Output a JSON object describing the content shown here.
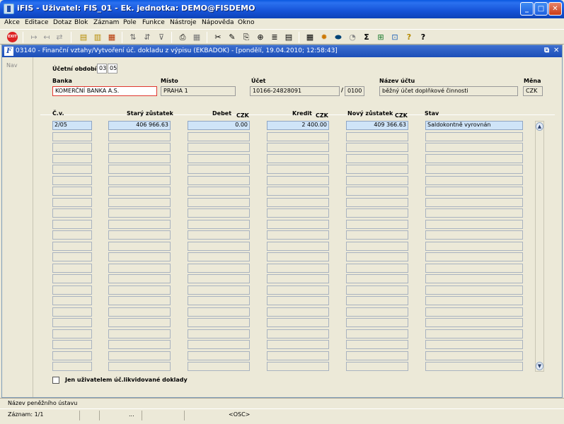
{
  "window": {
    "title": "iFIS - Uživatel: FIS_01 - Ek. jednotka: DEMO@FISDEMO",
    "min": "_",
    "max": "□",
    "close": "✕"
  },
  "menu": [
    "Akce",
    "Editace",
    "Dotaz",
    "Blok",
    "Záznam",
    "Pole",
    "Funkce",
    "Nástroje",
    "Nápověda",
    "Okno"
  ],
  "toolbar": {
    "exit_label": "EXIT",
    "icons": [
      "↦",
      "↤",
      "⇄",
      "▤",
      "▥",
      "▦",
      "⇅",
      "⇵",
      "⊽",
      "⎙",
      "▦",
      "✂",
      "✎",
      "⎘",
      "⊕",
      "≣",
      "▤",
      "▦",
      "✹",
      "⬬",
      "◔",
      "Σ",
      "⊞",
      "⊡",
      "?",
      "?"
    ]
  },
  "form": {
    "title": "03140 - Finanční vztahy/Vytvoření úč. dokladu z výpisu (EKBADOK) - [pondělí, 19.04.2010; 12:58:43]",
    "restore": "⧉",
    "close": "✕",
    "nav": "Nav",
    "period_label": "Účetní období",
    "period_year": "03",
    "period_month": "05",
    "bank_label": "Banka",
    "bank_value": "KOMERČNÍ BANKA A.S.",
    "place_label": "Místo",
    "place_value": "PRAHA 1",
    "account_label": "Účet",
    "account_value": "10166-24828091",
    "account_sep": "/",
    "bank_code": "0100",
    "account_name_label": "Název účtu",
    "account_name_value": "běžný účet doplňkové činnosti",
    "currency_label": "Měna",
    "currency_value": "CZK"
  },
  "table": {
    "headers": {
      "cv": "Č.v.",
      "old_balance": "Starý zůstatek",
      "debit": "Debet",
      "debit_cur": "CZK",
      "credit": "Kredit",
      "credit_cur": "CZK",
      "new_balance": "Nový zůstatek",
      "new_cur": "CZK",
      "state": "Stav"
    },
    "rows": [
      {
        "cv": "2/05",
        "old_balance": "406 966.63",
        "debit": "0.00",
        "credit": "2 400.00",
        "new_balance": "409 366.63",
        "state": "Saldokontně vyrovnán"
      }
    ],
    "scroll_up": "▲",
    "scroll_down": "▼"
  },
  "checkbox_label": "Jen uživatelem úč.likvidované doklady",
  "status": {
    "hint": "Název peněžního ústavu",
    "record": "Záznam: 1/1",
    "dots": "...",
    "osc": "<OSC>"
  }
}
